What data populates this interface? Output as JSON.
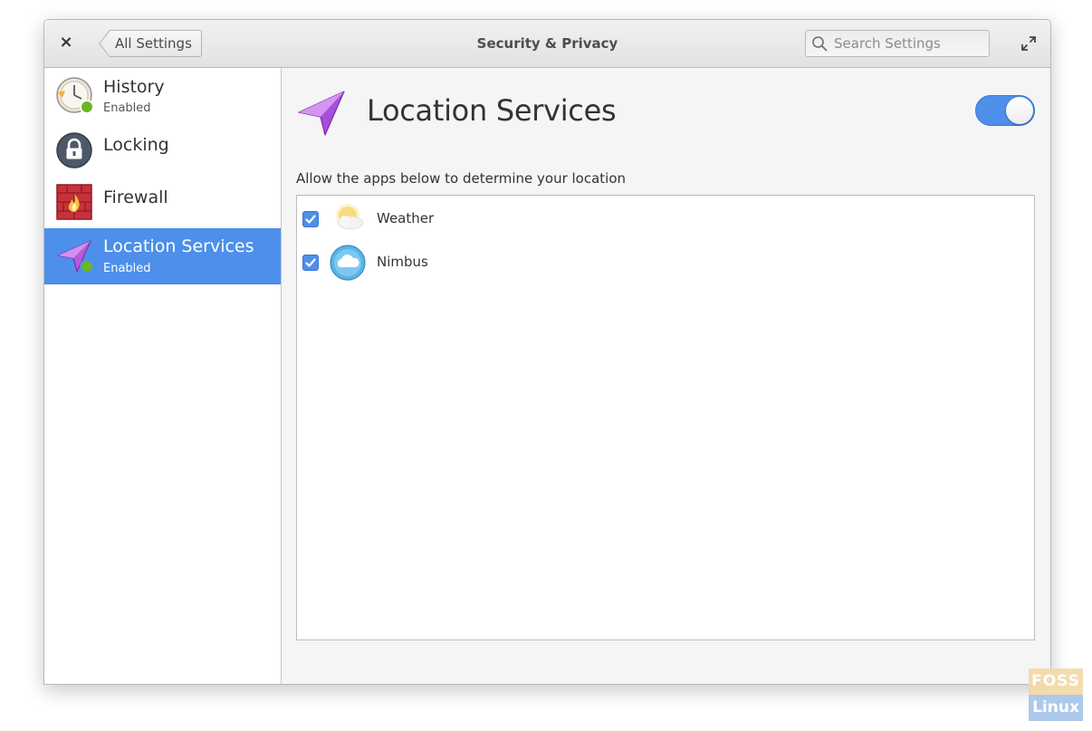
{
  "window": {
    "title": "Security & Privacy",
    "back_label": "All Settings",
    "search_placeholder": "Search Settings",
    "close_glyph": "×"
  },
  "sidebar": {
    "items": [
      {
        "label": "History",
        "sublabel": "Enabled",
        "icon": "history-clock-icon",
        "status": "enabled"
      },
      {
        "label": "Locking",
        "sublabel": "",
        "icon": "lock-icon"
      },
      {
        "label": "Firewall",
        "sublabel": "",
        "icon": "firewall-icon"
      },
      {
        "label": "Location Services",
        "sublabel": "Enabled",
        "icon": "location-arrow-icon",
        "status": "enabled",
        "selected": true
      }
    ]
  },
  "main": {
    "title": "Location Services",
    "toggle_on": true,
    "description": "Allow the apps below to determine your location",
    "apps": [
      {
        "name": "Weather",
        "checked": true,
        "icon": "weather-icon"
      },
      {
        "name": "Nimbus",
        "checked": true,
        "icon": "nimbus-cloud-icon"
      }
    ]
  },
  "watermark": {
    "top": "FOSS",
    "bottom": "Linux"
  },
  "colors": {
    "accent": "#4d8fea",
    "status_enabled": "#68b723",
    "location_purple": "#a74fd8"
  }
}
